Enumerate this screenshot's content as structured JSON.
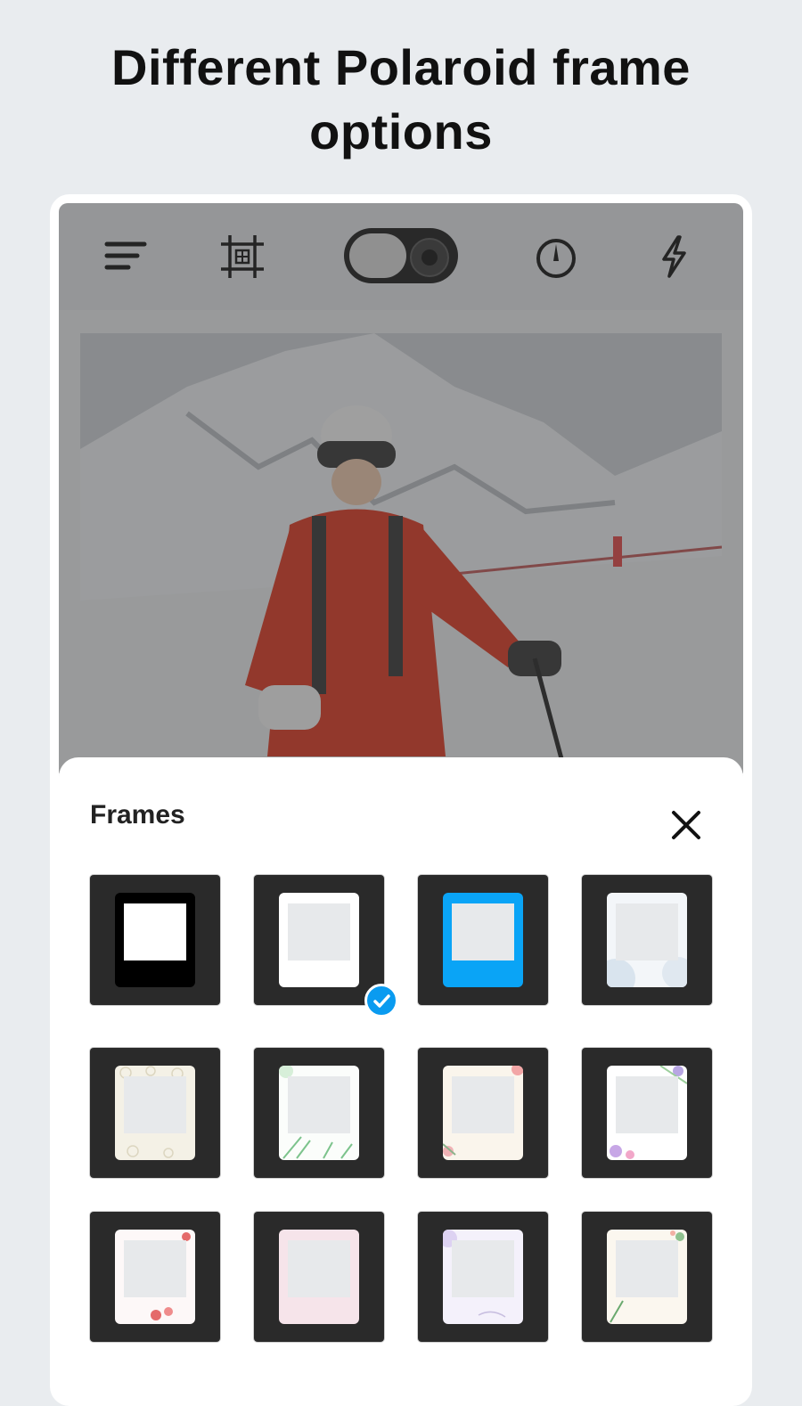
{
  "headline": {
    "line1": "Different Polaroid frame",
    "line2": "options"
  },
  "toolbar": {
    "icons": [
      "sort-lines-icon",
      "crop-grid-icon",
      "camera-switch-toggle",
      "timer-icon",
      "flash-icon"
    ]
  },
  "sheet": {
    "title": "Frames",
    "close_icon": "close-icon"
  },
  "frames": [
    {
      "id": "black",
      "selected": false
    },
    {
      "id": "white",
      "selected": true
    },
    {
      "id": "blue",
      "selected": false
    },
    {
      "id": "watercolor-blue",
      "selected": false
    },
    {
      "id": "cream-lace",
      "selected": false
    },
    {
      "id": "green-leaves",
      "selected": false
    },
    {
      "id": "peach-floral",
      "selected": false
    },
    {
      "id": "purple-floral",
      "selected": false
    },
    {
      "id": "red-blossom",
      "selected": false
    },
    {
      "id": "pink-wash",
      "selected": false
    },
    {
      "id": "lavender-script",
      "selected": false
    },
    {
      "id": "green-sprig",
      "selected": false
    }
  ],
  "colors": {
    "accent_blue": "#0aa4f6",
    "check_blue": "#0a9bf0",
    "tile_dark": "#2a2a2a"
  }
}
